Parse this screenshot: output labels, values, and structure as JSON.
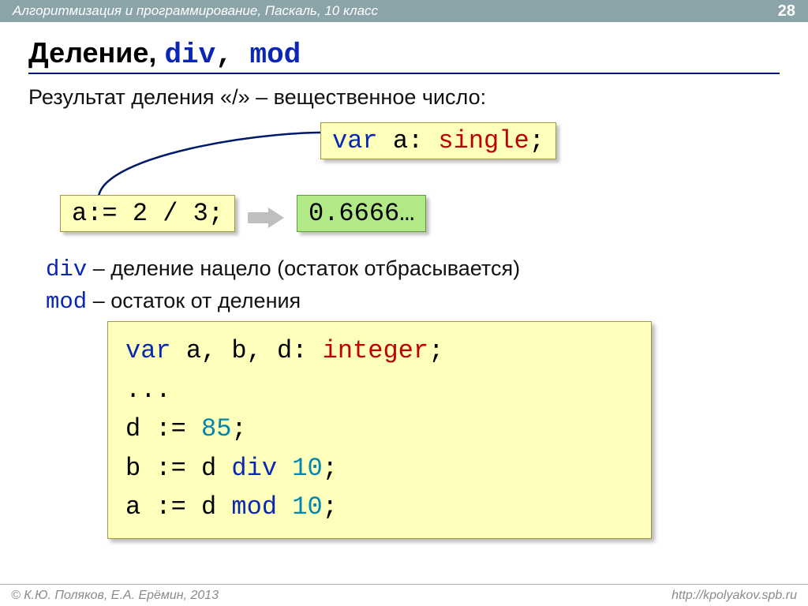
{
  "header": {
    "breadcrumb": "Алгоритмизация и программирование, Паскаль, 10 класс",
    "page_number": "28"
  },
  "title": {
    "t1": "Деление",
    "t2": "div",
    "t3": "mod"
  },
  "lead": "Результат деления «/» – вещественное число:",
  "box_var": {
    "kw_var": "var",
    "id": " a: ",
    "type": "single",
    "semi": ";"
  },
  "box_assign": "a:= 2 / 3;",
  "box_result": "0.6666…",
  "def_div": {
    "kw": "div",
    "text": " – деление нацело (остаток отбрасывается)"
  },
  "def_mod": {
    "kw": "mod",
    "text": " – остаток от деления"
  },
  "bigcode": {
    "l1_var": "var",
    "l1_rest": " a, b, d: ",
    "l1_type": "integer",
    "l1_semi": ";",
    "l2": "...",
    "l3_a": "d := ",
    "l3_num": "85",
    "l3_b": ";",
    "l4_a": "b := d ",
    "l4_kw": "div",
    "l4_b": " ",
    "l4_num": "10",
    "l4_c": ";",
    "l5_a": "a := d ",
    "l5_kw": "mod",
    "l5_b": " ",
    "l5_num": "10",
    "l5_c": ";"
  },
  "footer": {
    "authors": "© К.Ю. Поляков, Е.А. Ерёмин, 2013",
    "url": "http://kpolyakov.spb.ru"
  }
}
